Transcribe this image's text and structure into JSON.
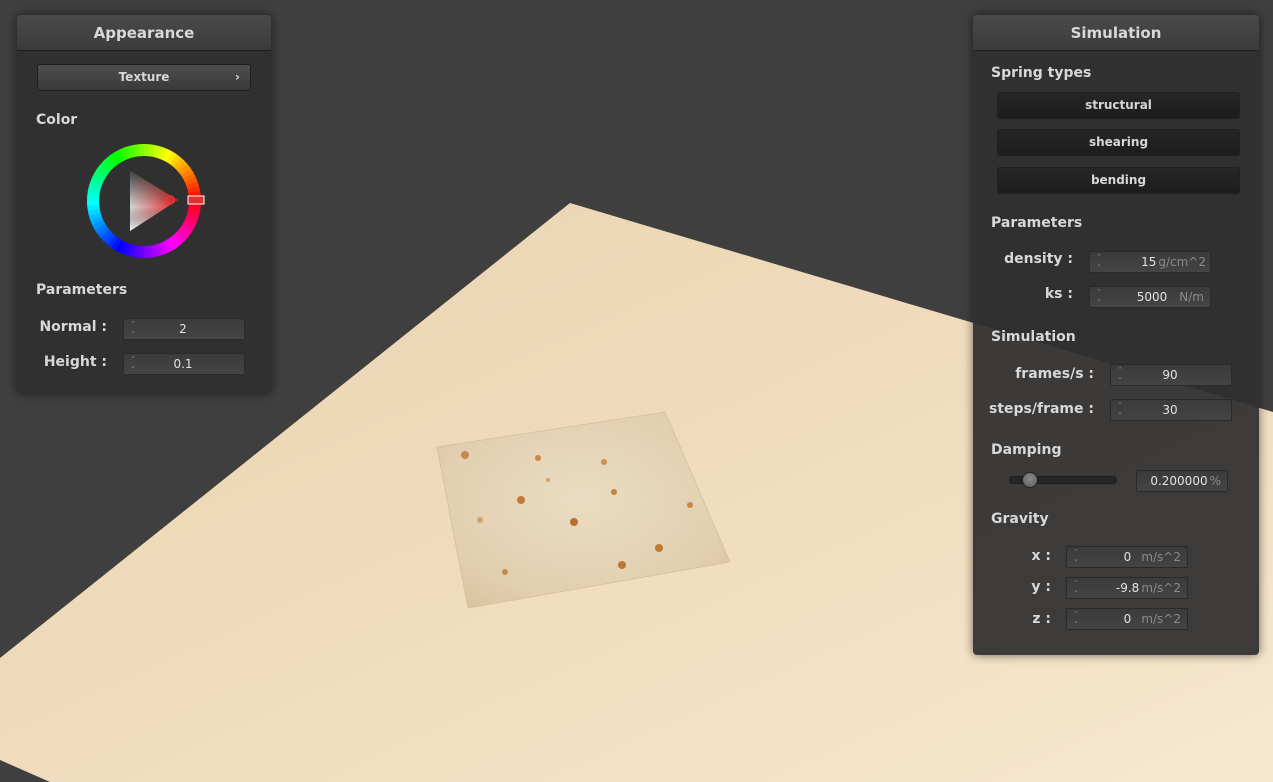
{
  "colors": {
    "background": "#3f3f3f",
    "plane": "#f1dec0",
    "panel": "#303030",
    "accent_red": "#e03030"
  },
  "appearance": {
    "title": "Appearance",
    "texture_button": "Texture",
    "texture_chevron": "›",
    "color_section": "Color",
    "parameters_section": "Parameters",
    "normal_label": "Normal :",
    "normal_value": "2",
    "height_label": "Height :",
    "height_value": "0.1"
  },
  "simulation": {
    "title": "Simulation",
    "spring_types_section": "Spring types",
    "spring_types": [
      "structural",
      "shearing",
      "bending"
    ],
    "parameters_section": "Parameters",
    "density_label": "density :",
    "density_value": "15",
    "density_unit": "g/cm^2",
    "ks_label": "ks :",
    "ks_value": "5000",
    "ks_unit": "N/m",
    "simulation_section": "Simulation",
    "fps_label": "frames/s :",
    "fps_value": "90",
    "steps_label": "steps/frame :",
    "steps_value": "30",
    "damping_section": "Damping",
    "damping_slider_fraction": 0.2,
    "damping_value": "0.200000",
    "damping_unit": "%",
    "gravity_section": "Gravity",
    "gx_label": "x :",
    "gx_value": "0",
    "gy_label": "y :",
    "gy_value": "-9.8",
    "gz_label": "z :",
    "gz_value": "0",
    "gravity_unit": "m/s^2"
  }
}
